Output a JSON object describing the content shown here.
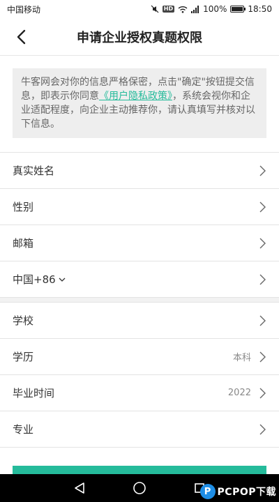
{
  "status_bar": {
    "carrier": "中国移动",
    "battery": "100%",
    "time": "18:50",
    "icons": [
      "mute-icon",
      "hd-icon",
      "wifi-icon",
      "signal-icon",
      "battery-icon"
    ]
  },
  "header": {
    "title": "申请企业授权真题权限",
    "back_icon": "back-arrow-icon"
  },
  "notice": {
    "text_before": "牛客网会对你的信息严格保密，点击\"确定\"按钮提交信息，即表示你同意",
    "link": "《用户隐私政策》",
    "text_after": "，系统会视你和企业适配程度，向企业主动推荐你，请认真填写并核对以下信息。",
    "link_color": "#25bb9b"
  },
  "form_group_1": [
    {
      "label": "真实姓名",
      "value": ""
    },
    {
      "label": "性别",
      "value": ""
    },
    {
      "label": "邮箱",
      "value": ""
    },
    {
      "label": "中国+86",
      "value": ""
    }
  ],
  "form_group_2": [
    {
      "label": "学校",
      "value": ""
    },
    {
      "label": "学历",
      "value": "本科"
    },
    {
      "label": "毕业时间",
      "value": "2022"
    },
    {
      "label": "专业",
      "value": ""
    }
  ],
  "accent_color": "#25bb9b",
  "watermark": {
    "logo_letter": "P",
    "text": "PCPOP下载"
  }
}
